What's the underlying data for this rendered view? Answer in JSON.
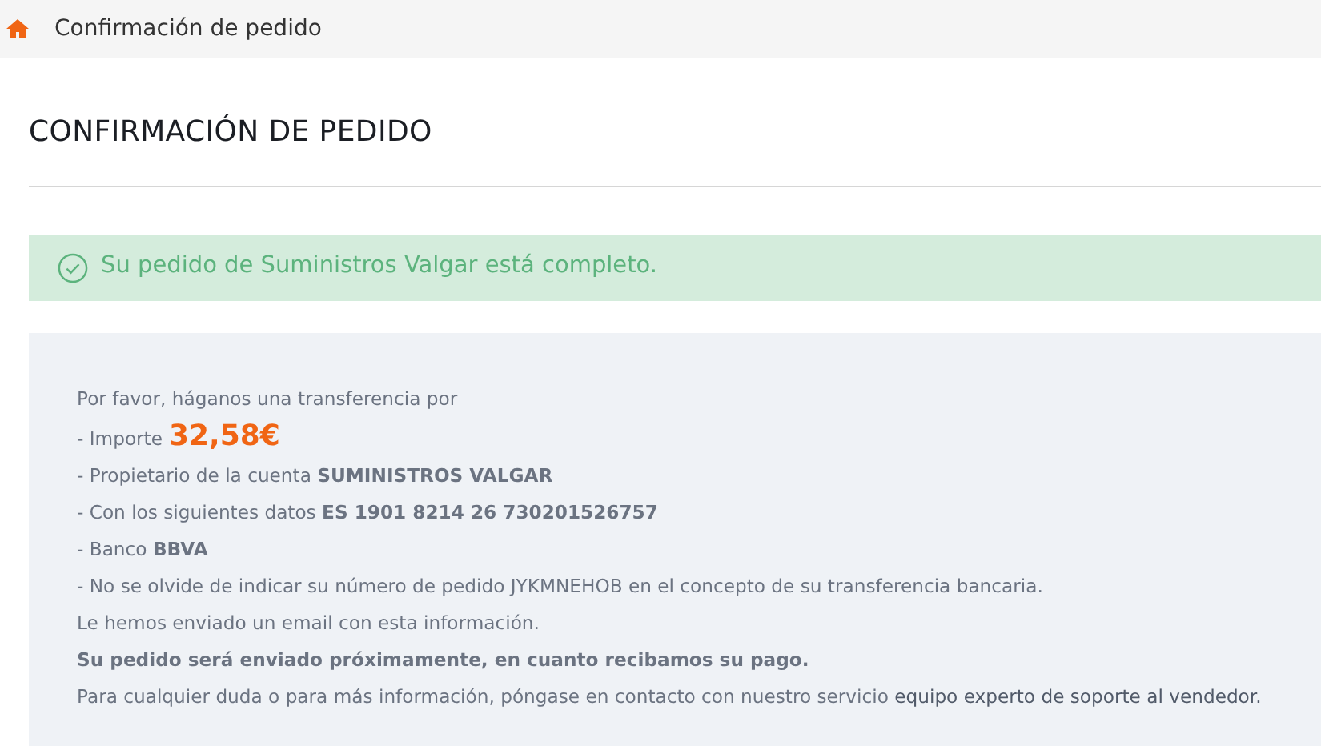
{
  "breadcrumb": {
    "label": "Confirmación de pedido"
  },
  "title": "CONFIRMACIÓN DE PEDIDO",
  "alert": {
    "text": "Su pedido de Suministros Valgar está completo."
  },
  "instructions": [
    {
      "kind": "text",
      "text": "Por favor, háganos una transferencia por"
    },
    {
      "kind": "amount",
      "text": "- Importe",
      "amount": "32,58€"
    },
    {
      "kind": "text",
      "text": "- Propietario de la cuenta **SUMINISTROS VALGAR**"
    },
    {
      "kind": "text",
      "text": "- Con los siguientes datos **ES 1901 8214 26 730201526757**"
    },
    {
      "kind": "text",
      "text": "- Banco **BBVA**"
    },
    {
      "kind": "text",
      "text": "- No se olvide de indicar su número de pedido JYKMNEHOB en el concepto de su transferencia bancaria."
    },
    {
      "kind": "text",
      "text": "Le hemos enviado un email con esta información."
    },
    {
      "kind": "bold",
      "text": "Su pedido será enviado próximamente, en cuanto recibamos su pago."
    },
    {
      "kind": "link",
      "text": "Para cualquier duda o para más información, póngase en contacto con nuestro servicio",
      "link": "equipo experto de soporte al vendedor."
    }
  ]
}
